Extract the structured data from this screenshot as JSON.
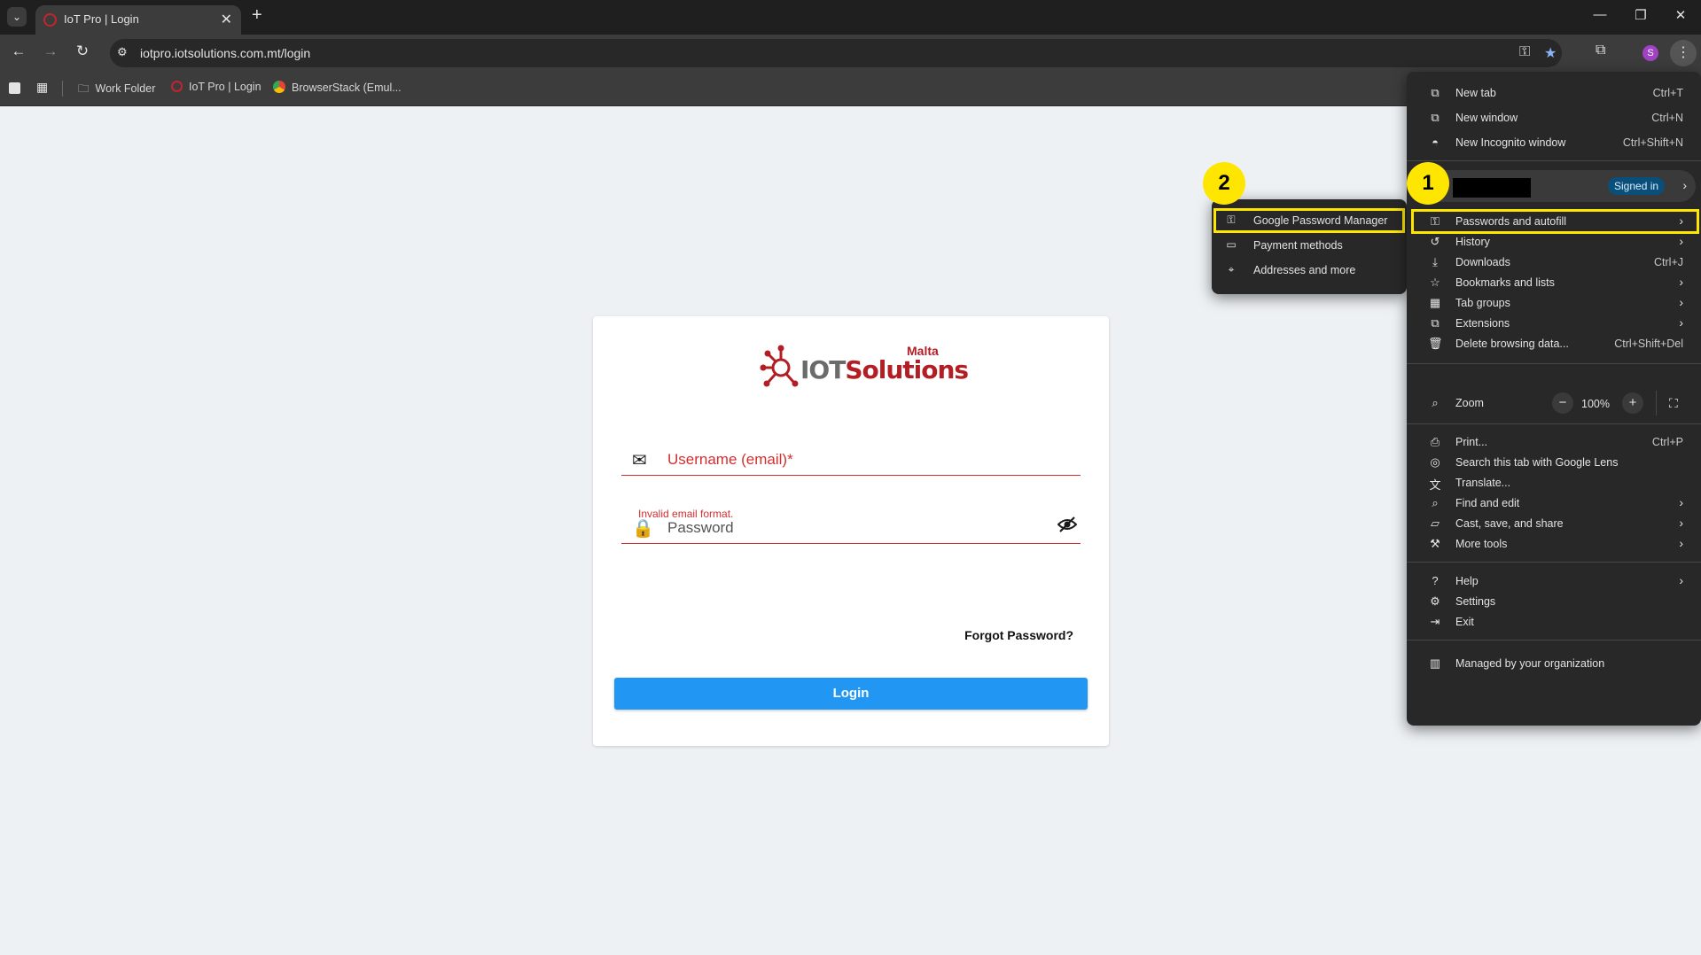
{
  "browser": {
    "tab_title": "IoT Pro | Login",
    "url": "iotpro.iotsolutions.com.mt/login",
    "avatar_letter": "S",
    "bookmarks": [
      {
        "label": "Work Folder",
        "icon": "folder-icon"
      },
      {
        "label": "IoT Pro | Login",
        "icon": "iot-favicon"
      },
      {
        "label": "BrowserStack (Emul...",
        "icon": "chrome-icon"
      }
    ]
  },
  "login": {
    "logo_text_iot": "IOT",
    "logo_text_solutions": "Solutions",
    "logo_text_malta": "Malta",
    "username_label": "Username (email)*",
    "username_error": "Invalid email format.",
    "password_label": "Password",
    "forgot_label": "Forgot Password?",
    "login_label": "Login"
  },
  "menu": {
    "new_tab": {
      "label": "New tab",
      "shortcut": "Ctrl+T"
    },
    "new_window": {
      "label": "New window",
      "shortcut": "Ctrl+N"
    },
    "incognito": {
      "label": "New Incognito window",
      "shortcut": "Ctrl+Shift+N"
    },
    "signed_in": "Signed in",
    "passwords": {
      "label": "Passwords and autofill"
    },
    "history": {
      "label": "History"
    },
    "downloads": {
      "label": "Downloads",
      "shortcut": "Ctrl+J"
    },
    "bookmarks": {
      "label": "Bookmarks and lists"
    },
    "tab_groups": {
      "label": "Tab groups"
    },
    "extensions": {
      "label": "Extensions"
    },
    "delete_data": {
      "label": "Delete browsing data...",
      "shortcut": "Ctrl+Shift+Del"
    },
    "zoom": {
      "label": "Zoom",
      "value": "100%"
    },
    "print": {
      "label": "Print...",
      "shortcut": "Ctrl+P"
    },
    "lens": {
      "label": "Search this tab with Google Lens"
    },
    "translate": {
      "label": "Translate..."
    },
    "find": {
      "label": "Find and edit"
    },
    "cast": {
      "label": "Cast, save, and share"
    },
    "more_tools": {
      "label": "More tools"
    },
    "help": {
      "label": "Help"
    },
    "settings": {
      "label": "Settings"
    },
    "exit": {
      "label": "Exit"
    },
    "managed": {
      "label": "Managed by your organization"
    }
  },
  "submenu": {
    "password_manager": "Google Password Manager",
    "payment_methods": "Payment methods",
    "addresses": "Addresses and more"
  },
  "annotations": {
    "step1": "1",
    "step2": "2",
    "highlight_color": "#ffe600"
  }
}
